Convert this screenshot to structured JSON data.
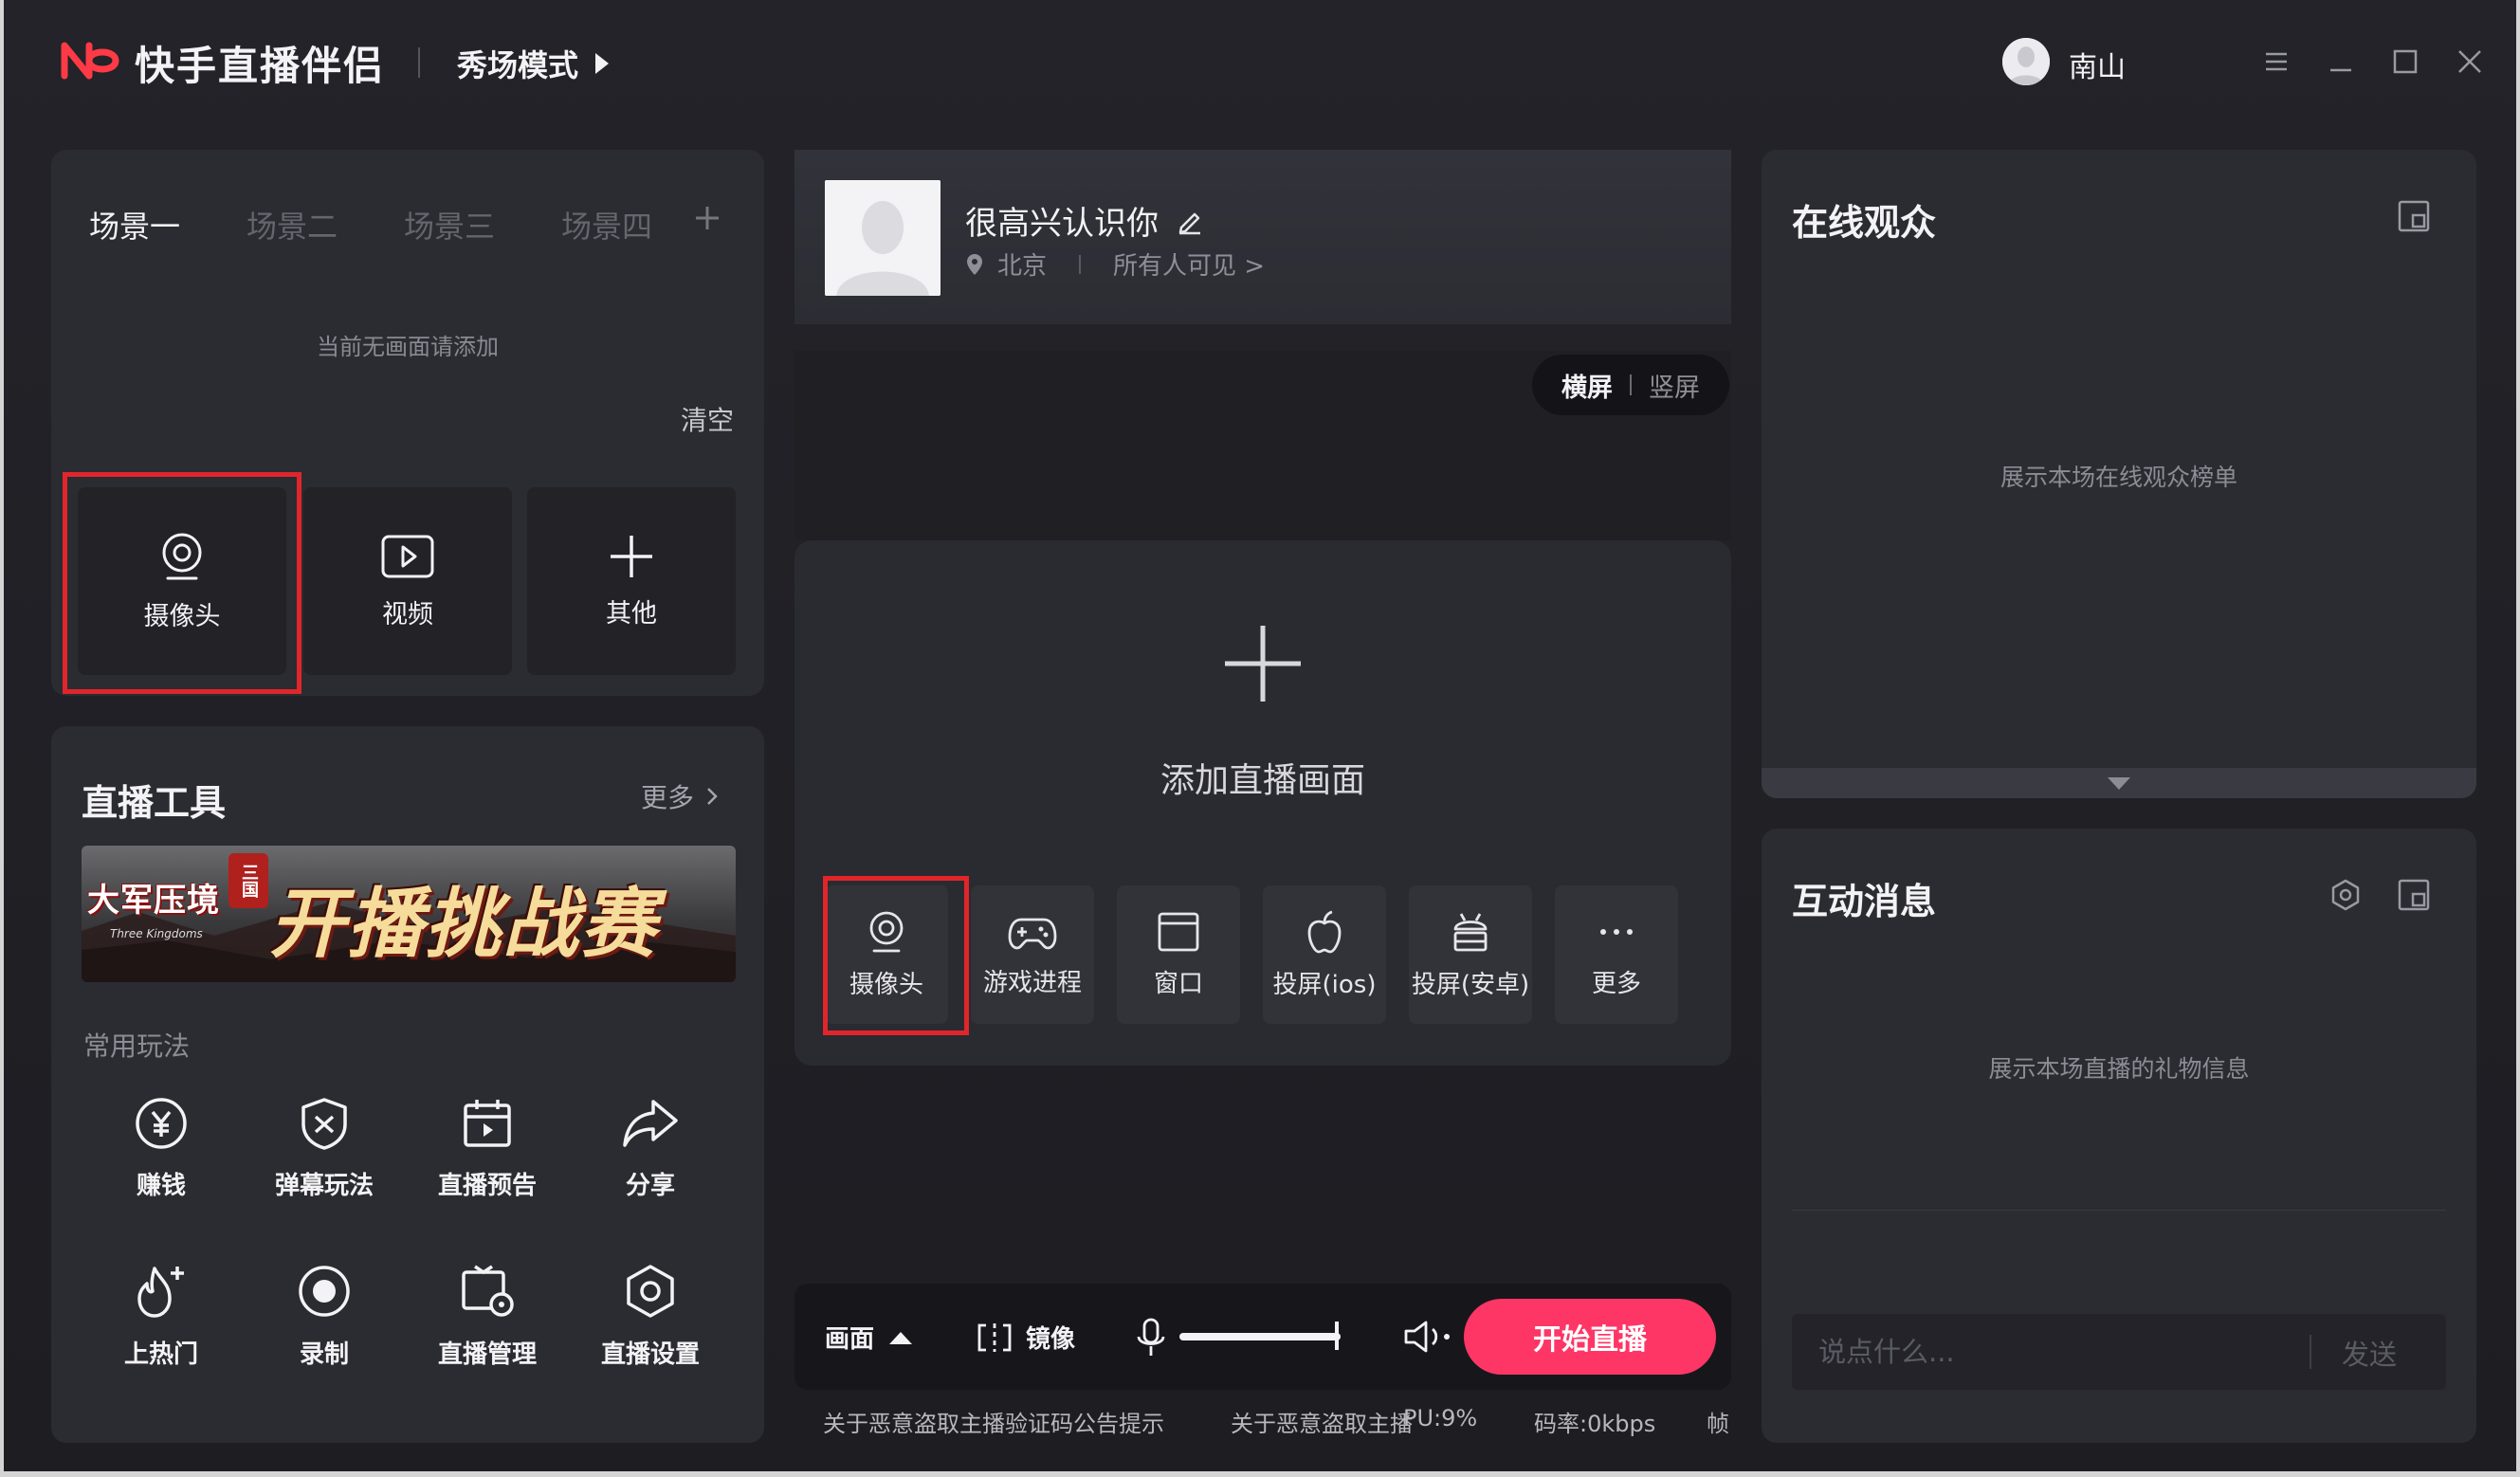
{
  "titlebar": {
    "app_name": "快手直播伴侣",
    "mode_label": "秀场模式",
    "username": "南山",
    "brand_color": "#fe3a46",
    "controls": [
      "menu-icon",
      "minimize-icon",
      "maximize-icon",
      "close-icon"
    ]
  },
  "scenes": {
    "tabs": [
      "场景一",
      "场景二",
      "场景三",
      "场景四"
    ],
    "active_index": 0,
    "add_icon": "plus-icon",
    "empty_hint": "当前无画面请添加",
    "clear_label": "清空",
    "sources": [
      {
        "label": "摄像头",
        "icon": "camera-icon"
      },
      {
        "label": "视频",
        "icon": "video-icon"
      },
      {
        "label": "其他",
        "icon": "plus-icon"
      }
    ]
  },
  "tools": {
    "title": "直播工具",
    "more_label": "更多",
    "banner": {
      "logo_text": "大军压境",
      "badge_text": "三国",
      "main_text": "开播挑战赛",
      "sub_text": "Three Kingdoms"
    },
    "section_label": "常用玩法",
    "items": [
      {
        "label": "赚钱",
        "icon": "yen-coin-icon"
      },
      {
        "label": "弹幕玩法",
        "icon": "danmaku-shield-icon"
      },
      {
        "label": "直播预告",
        "icon": "calendar-play-icon"
      },
      {
        "label": "分享",
        "icon": "share-arrow-icon"
      },
      {
        "label": "上热门",
        "icon": "flame-plus-icon"
      },
      {
        "label": "录制",
        "icon": "record-icon"
      },
      {
        "label": "直播管理",
        "icon": "live-manage-icon"
      },
      {
        "label": "直播设置",
        "icon": "settings-hex-icon"
      }
    ]
  },
  "topic": {
    "title": "很高兴认识你",
    "location": "北京",
    "visibility": "所有人可见 >"
  },
  "orientation": {
    "landscape": "横屏",
    "portrait": "竖屏",
    "active": "landscape"
  },
  "add_scene": {
    "label": "添加直播画面",
    "quick_sources": [
      {
        "label": "摄像头",
        "icon": "camera-icon"
      },
      {
        "label": "游戏进程",
        "icon": "gamepad-icon"
      },
      {
        "label": "窗口",
        "icon": "window-icon"
      },
      {
        "label": "投屏(ios)",
        "icon": "apple-icon"
      },
      {
        "label": "投屏(安卓)",
        "icon": "android-icon"
      },
      {
        "label": "更多",
        "icon": "more-dots-icon"
      }
    ]
  },
  "bottom_bar": {
    "scene_label": "画面",
    "mirror_label": "镜像",
    "start_label": "开始直播",
    "start_color": "#fe3666"
  },
  "status": {
    "notice_1": "关于恶意盗取主播验证码公告提示",
    "notice_2": "关于恶意盗取主播",
    "cpu": "PU:9%",
    "bitrate": "码率:0kbps",
    "fps": "帧"
  },
  "audience": {
    "title": "在线观众",
    "hint": "展示本场在线观众榜单"
  },
  "messages": {
    "title": "互动消息",
    "hint": "展示本场直播的礼物信息",
    "input_placeholder": "说点什么...",
    "send_label": "发送"
  }
}
